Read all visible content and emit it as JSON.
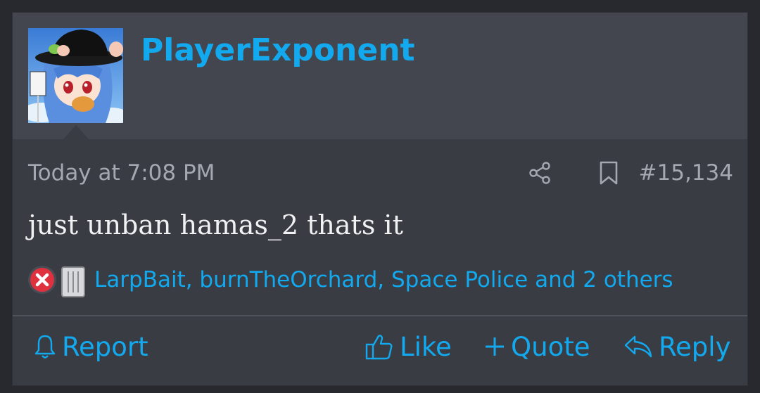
{
  "post": {
    "username": "PlayerExponent",
    "timestamp": "Today at 7:08 PM",
    "post_number": "#15,134",
    "body": "just unban hamas_2 thats it",
    "reactors": "LarpBait, burnTheOrchard, Space Police and 2 others",
    "reaction_icons": [
      "x-reaction-icon",
      "trash-reaction-icon"
    ]
  },
  "actions": {
    "report": "Report",
    "like": "Like",
    "quote": "Quote",
    "reply": "Reply"
  },
  "icons": [
    "share-icon",
    "bookmark-icon",
    "bell-icon",
    "thumbs-up-icon",
    "plus-icon",
    "reply-arrow-icon"
  ],
  "colors": {
    "accent": "#12a9ef",
    "post_background": "#393c43",
    "header_background": "#43464e",
    "body_text": "#f0f1f3",
    "meta_text": "#a4a8b0"
  }
}
